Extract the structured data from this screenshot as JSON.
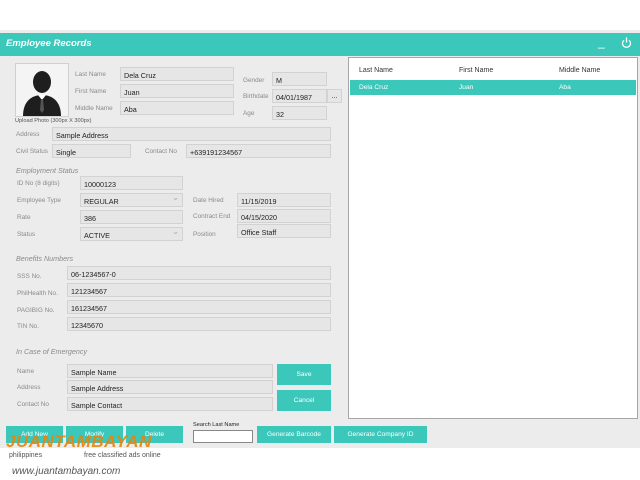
{
  "window": {
    "title": "Employee Records",
    "minimize_glyph": "_",
    "power_icon": "power-icon"
  },
  "photo": {
    "caption": "Upload Photo (300px X 300px)",
    "icon": "user-silhouette-icon"
  },
  "personal": {
    "last_name": {
      "label": "Last Name",
      "value": "Dela Cruz"
    },
    "first_name": {
      "label": "First Name",
      "value": "Juan"
    },
    "middle_name": {
      "label": "Middle Name",
      "value": "Aba"
    },
    "gender": {
      "label": "Gender",
      "value": "M"
    },
    "birthdate": {
      "label": "Birthdate",
      "value": "04/01/1987",
      "picker": "..."
    },
    "age": {
      "label": "Age",
      "value": "32"
    },
    "address": {
      "label": "Address",
      "value": "Sample Address"
    },
    "civil_status": {
      "label": "Civil Status",
      "value": "Single"
    },
    "contact_no": {
      "label": "Contact No",
      "value": "+639191234567"
    }
  },
  "employment": {
    "heading": "Employment Status",
    "id_no": {
      "label": "ID No (8 digits)",
      "value": "10000123"
    },
    "employee_type": {
      "label": "Employee Type",
      "value": "REGULAR"
    },
    "rate": {
      "label": "Rate",
      "value": "386"
    },
    "status": {
      "label": "Status",
      "value": "ACTIVE"
    },
    "date_hired": {
      "label": "Date Hired",
      "value": "11/15/2019"
    },
    "contract_end": {
      "label": "Contract End",
      "value": "04/15/2020"
    },
    "position": {
      "label": "Position",
      "value": "Office Staff"
    }
  },
  "benefits": {
    "heading": "Benefits Numbers",
    "sss": {
      "label": "SSS No.",
      "value": "06-1234567-0"
    },
    "philhealth": {
      "label": "PhilHealth No.",
      "value": "121234567"
    },
    "pagibig": {
      "label": "PAGIBIG No.",
      "value": "161234567"
    },
    "tin": {
      "label": "TIN No.",
      "value": "12345670"
    }
  },
  "emergency": {
    "heading": "In Case of Emergency",
    "name": {
      "label": "Name",
      "value": "Sample Name"
    },
    "address": {
      "label": "Address",
      "value": "Sample Address"
    },
    "contact": {
      "label": "Contact No",
      "value": "Sample Contact"
    }
  },
  "actions": {
    "save": "Save",
    "cancel": "Cancel",
    "add_new": "Add New",
    "modify": "Modify",
    "delete": "Delete",
    "search_label": "Search Last Name",
    "search_value": "",
    "generate_barcode": "Generate Barcode",
    "generate_company_id": "Generate Company ID"
  },
  "grid": {
    "columns": [
      "Last Name",
      "First Name",
      "Middle Name"
    ],
    "rows": [
      [
        "Dela Cruz",
        "Juan",
        "Aba"
      ]
    ]
  },
  "watermark": {
    "brand": "JUANTAMBAYAN",
    "country": "philippines",
    "tagline": "free classified ads online",
    "url": "www.juantambayan.com"
  },
  "colors": {
    "accent": "#3cc7bb",
    "field_bg": "#e6e6e6",
    "watermark_orange": "#e8850c",
    "watermark_gray": "#555555"
  }
}
